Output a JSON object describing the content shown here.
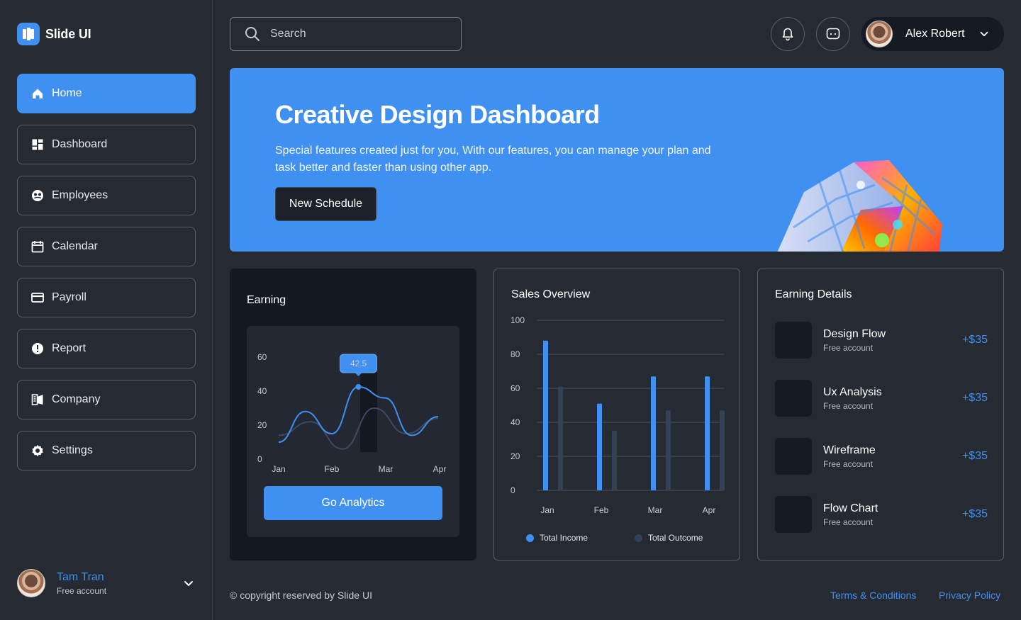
{
  "app": {
    "name": "Slide UI",
    "brand_color": "#3F90F1"
  },
  "sidebar": {
    "items": [
      {
        "label": "Home",
        "icon": "home-icon"
      },
      {
        "label": "Dashboard",
        "icon": "dashboard-icon"
      },
      {
        "label": "Employees",
        "icon": "employees-icon"
      },
      {
        "label": "Calendar",
        "icon": "calendar-icon"
      },
      {
        "label": "Payroll",
        "icon": "payroll-icon"
      },
      {
        "label": "Report",
        "icon": "report-icon"
      },
      {
        "label": "Company",
        "icon": "company-icon"
      },
      {
        "label": "Settings",
        "icon": "gear-icon"
      }
    ],
    "active": "Home",
    "user": {
      "name": "Tam Tran",
      "subtitle": "Free account"
    }
  },
  "header": {
    "search_placeholder": "Search",
    "profile_name": "Alex Robert"
  },
  "banner": {
    "title": "Creative Design Dashboard",
    "description": "Special features created just for you, With our features, you can manage your plan and task better and faster than using other app.",
    "button_label": "New Schedule"
  },
  "earning": {
    "title": "Earning",
    "button_label": "Go Analytics",
    "tooltip_value": "42.5"
  },
  "sales": {
    "title": "Sales Overview"
  },
  "details": {
    "title": "Earning Details",
    "rows": [
      {
        "name": "Design Flow",
        "subtitle": "Free account",
        "amount": "+$35"
      },
      {
        "name": "Ux Analysis",
        "subtitle": "Free account",
        "amount": "+$35"
      },
      {
        "name": "Wireframe",
        "subtitle": "Free account",
        "amount": "+$35"
      },
      {
        "name": "Flow Chart",
        "subtitle": "Free account",
        "amount": "+$35"
      }
    ]
  },
  "footer": {
    "copyright": "© copyright reserved by Slide UI",
    "terms": "Terms & Conditions",
    "privacy": "Privacy Policy"
  },
  "chart_data": [
    {
      "type": "line",
      "title": "Earning",
      "x": [
        "Jan",
        "Feb",
        "Mar",
        "Apr"
      ],
      "ylim": [
        0,
        60
      ],
      "yticks": [
        0,
        20,
        40,
        60
      ],
      "series": [
        {
          "values": [
            10,
            28,
            15,
            42.5,
            36,
            14,
            25
          ]
        },
        {
          "values": [
            14,
            22,
            6,
            30,
            15,
            24
          ]
        }
      ],
      "highlight": {
        "x": "Mar",
        "label": "42.5"
      },
      "colors": {
        "primary": "#3F90F1",
        "secondary": "#3B4A63"
      }
    },
    {
      "type": "bar",
      "title": "Sales Overview",
      "categories": [
        "Jan",
        "Feb",
        "Mar",
        "Apr"
      ],
      "ylim": [
        0,
        100
      ],
      "yticks": [
        0,
        20,
        40,
        60,
        80,
        100
      ],
      "series": [
        {
          "name": "Total Income",
          "values": [
            88,
            51,
            67,
            67
          ],
          "color": "#3F90F1"
        },
        {
          "name": "Total Outcome",
          "values": [
            61,
            35,
            47,
            47
          ],
          "color": "#344258"
        }
      ],
      "grid": true,
      "legend": "bottom"
    }
  ]
}
